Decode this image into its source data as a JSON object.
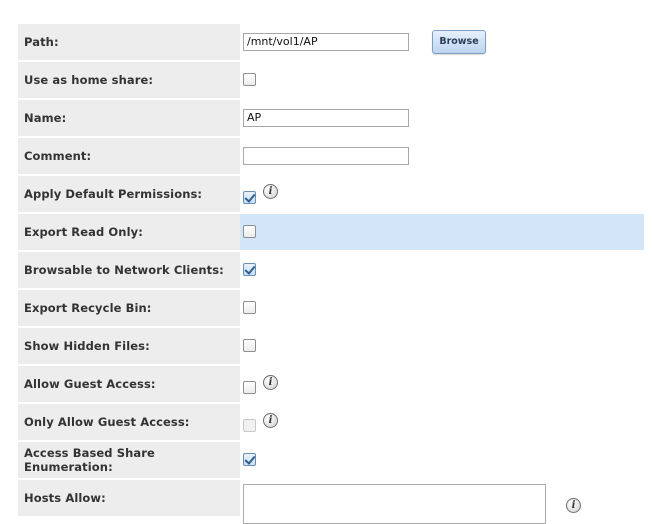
{
  "share_form": {
    "path": {
      "label": "Path:",
      "value": "/mnt/vol1/AP",
      "browse_label": "Browse"
    },
    "home_share": {
      "label": "Use as home share:",
      "checked": false
    },
    "name": {
      "label": "Name:",
      "value": "AP"
    },
    "comment": {
      "label": "Comment:",
      "value": ""
    },
    "apply_default_permissions": {
      "label": "Apply Default Permissions:",
      "checked": true
    },
    "export_read_only": {
      "label": "Export Read Only:",
      "checked": false
    },
    "browsable": {
      "label": "Browsable to Network Clients:",
      "checked": true
    },
    "export_recycle_bin": {
      "label": "Export Recycle Bin:",
      "checked": false
    },
    "show_hidden_files": {
      "label": "Show Hidden Files:",
      "checked": false
    },
    "allow_guest_access": {
      "label": "Allow Guest Access:",
      "checked": false
    },
    "only_allow_guest_access": {
      "label": "Only Allow Guest Access:",
      "checked": false,
      "disabled": true
    },
    "access_based_enumeration": {
      "label": "Access Based Share Enumeration:",
      "checked": true
    },
    "hosts_allow": {
      "label": "Hosts Allow:",
      "value": ""
    }
  },
  "icons": {
    "info_glyph": "i"
  },
  "colors": {
    "label_background": "#ededed",
    "highlight_background": "#d3e6f8",
    "button_border": "#7f9fc4"
  }
}
